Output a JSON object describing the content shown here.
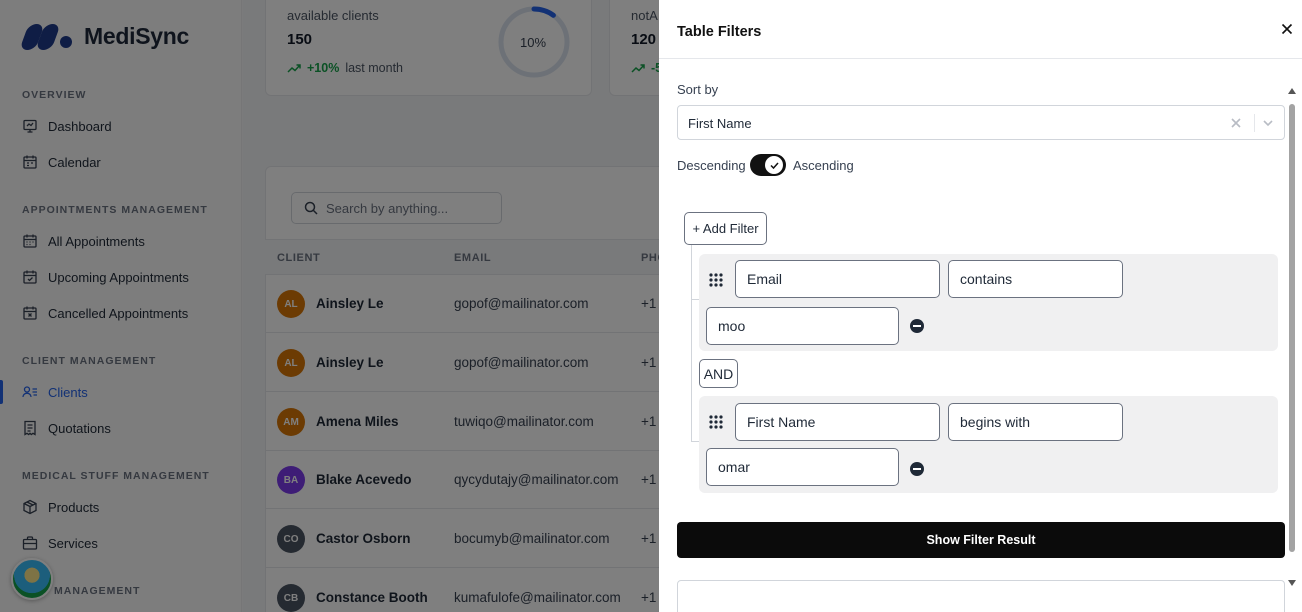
{
  "app": {
    "name": "MediSync"
  },
  "sidebar": {
    "sections": [
      {
        "title": "OVERVIEW"
      },
      {
        "title": "APPOINTMENTS MANAGEMENT"
      },
      {
        "title": "CLIENT MANAGEMENT"
      },
      {
        "title": "MEDICAL STUFF MANAGEMENT"
      },
      {
        "title": "MANAGEMENT"
      }
    ],
    "items": [
      {
        "label": "Dashboard",
        "icon": "presentation-icon"
      },
      {
        "label": "Calendar",
        "icon": "calendar-icon"
      },
      {
        "label": "All Appointments",
        "icon": "calendar-grid-icon"
      },
      {
        "label": "Upcoming Appointments",
        "icon": "calendar-check-icon"
      },
      {
        "label": "Cancelled Appointments",
        "icon": "calendar-x-icon"
      },
      {
        "label": "Clients",
        "icon": "users-list-icon",
        "active": true
      },
      {
        "label": "Quotations",
        "icon": "receipt-icon"
      },
      {
        "label": "Products",
        "icon": "box-icon"
      },
      {
        "label": "Services",
        "icon": "briefcase-icon"
      }
    ]
  },
  "stats": [
    {
      "label": "available clients",
      "value": "150",
      "trend": "+10%",
      "trend_suffix": "last month",
      "ring_label": "10%",
      "ring_fraction": 0.1
    },
    {
      "label": "notA",
      "value": "120",
      "trend": "-5"
    }
  ],
  "table": {
    "search_placeholder": "Search by anything...",
    "columns": [
      "CLIENT",
      "EMAIL",
      "PHO"
    ],
    "rows": [
      {
        "initials": "AL",
        "name": "Ainsley Le",
        "email": "gopof@mailinator.com",
        "phone": "+1",
        "color": "#d97706"
      },
      {
        "initials": "AL",
        "name": "Ainsley Le",
        "email": "gopof@mailinator.com",
        "phone": "+1",
        "color": "#d97706"
      },
      {
        "initials": "AM",
        "name": "Amena Miles",
        "email": "tuwiqo@mailinator.com",
        "phone": "+1",
        "color": "#d97706"
      },
      {
        "initials": "BA",
        "name": "Blake Acevedo",
        "email": "qycydutajy@mailinator.com",
        "phone": "+1",
        "color": "#7c3aed"
      },
      {
        "initials": "CO",
        "name": "Castor Osborn",
        "email": "bocumyb@mailinator.com",
        "phone": "+1",
        "color": "#4b5563"
      },
      {
        "initials": "CB",
        "name": "Constance Booth",
        "email": "kumafulofe@mailinator.com",
        "phone": "+1",
        "color": "#4b5563"
      }
    ]
  },
  "drawer": {
    "title": "Table Filters",
    "sort_label": "Sort by",
    "sort_value": "First Name",
    "order_left": "Descending",
    "order_right": "Ascending",
    "order_ascending": true,
    "add_filter_label": "+ Add Filter",
    "logic_operator": "AND",
    "filters": [
      {
        "field": "Email",
        "operator": "contains",
        "value": "moo"
      },
      {
        "field": "First Name",
        "operator": "begins with",
        "value": "omar"
      }
    ],
    "submit_label": "Show Filter Result"
  },
  "colors": {
    "accent": "#2563eb",
    "trend_up": "#16a34a",
    "primary_button": "#0b0b0b"
  }
}
